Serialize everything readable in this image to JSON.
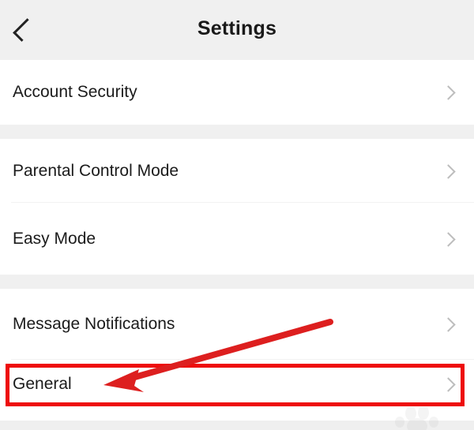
{
  "header": {
    "title": "Settings",
    "back_icon": "chevron-left-icon"
  },
  "groups": [
    {
      "items": [
        {
          "label": "Account Security",
          "chevron_icon": "chevron-right-icon"
        }
      ]
    },
    {
      "items": [
        {
          "label": "Parental Control Mode",
          "chevron_icon": "chevron-right-icon"
        },
        {
          "label": "Easy Mode",
          "chevron_icon": "chevron-right-icon"
        }
      ]
    },
    {
      "items": [
        {
          "label": "Message Notifications",
          "chevron_icon": "chevron-right-icon"
        },
        {
          "label": "General",
          "chevron_icon": "chevron-right-icon"
        }
      ]
    }
  ],
  "annotations": {
    "highlight_color": "#ee0b0b",
    "arrow_color": "#dd1f1f",
    "highlight_target": "General",
    "arrow_icon": "arrow-pointing-left-icon"
  },
  "theme": {
    "background": "#ffffff",
    "band": "#f0f0f0",
    "text": "#1b1b1b",
    "chevron": "#bdbdbd"
  },
  "watermark": {
    "icon": "paw-print-watermark"
  }
}
